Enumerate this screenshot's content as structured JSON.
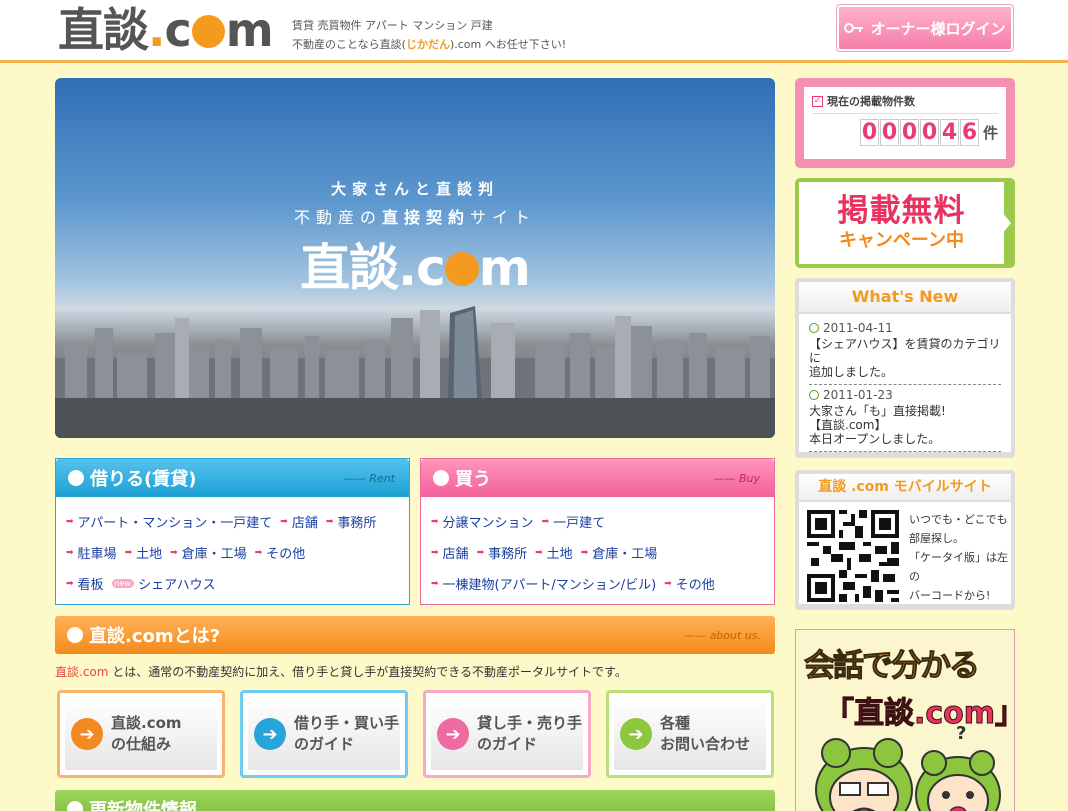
{
  "header": {
    "logo": {
      "main": "直談",
      "dot": ".",
      "c": "c",
      "m": "m"
    },
    "tagline_line1": "賃貸 売買物件 アパート マンション 戸建",
    "tagline_pre": "不動産のことなら直談(",
    "tagline_highlight": "じかだん",
    "tagline_post": ").com へお任せ下さい!",
    "owner_login": "オーナー様ログイン"
  },
  "hero": {
    "line1": "大家さんと直談判",
    "line2_pre": "不動産の",
    "line2_bold": "直接契約",
    "line2_post": "サイト",
    "logo_main": "直談.c",
    "logo_tail": "m"
  },
  "rent": {
    "title": "借りる(賃貸)",
    "en": "Rent",
    "rows": [
      [
        "アパート・マンション・一戸建て",
        "店舗",
        "事務所"
      ],
      [
        "駐車場",
        "土地",
        "倉庫・工場",
        "その他"
      ],
      [
        "看板"
      ]
    ],
    "new_badge": "new",
    "new_item": "シェアハウス"
  },
  "buy": {
    "title": "買う",
    "en": "Buy",
    "rows": [
      [
        "分譲マンション",
        "一戸建て"
      ],
      [
        "店舗",
        "事務所",
        "土地",
        "倉庫・工場"
      ],
      [
        "一棟建物(アパート/マンション/ビル)",
        "その他"
      ]
    ]
  },
  "about": {
    "title": "直談.comとは?",
    "en": "about us.",
    "brand": "直談.com",
    "text": " とは、通常の不動産契約に加え、借り手と貸し手が直接契約できる不動産ポータルサイトです。",
    "guides": [
      "直談.com\nの仕組み",
      "借り手・買い手\nのガイド",
      "貸し手・売り手\nのガイド",
      "各種\nお問い合わせ"
    ]
  },
  "update": {
    "title": "更新物件情報"
  },
  "counter": {
    "title": "現在の掲載物件数",
    "digits": [
      "0",
      "0",
      "0",
      "0",
      "4",
      "6"
    ],
    "unit": "件"
  },
  "free": {
    "big": "掲載無料",
    "small": "キャンペーン中"
  },
  "news": {
    "title": "What's New",
    "entries": [
      {
        "date": "2011-04-11",
        "text_l1": "【シェアハウス】を賃貸のカテゴリに",
        "text_l2": "追加しました。"
      },
      {
        "date": "2011-01-23",
        "text_l1": "大家さん「も」直接掲載!",
        "text_l2": "【直談.com】",
        "text_l3": "本日オープンしました。"
      }
    ]
  },
  "mobile": {
    "title": "直談 .com モバイルサイト",
    "text": "いつでも・どこでも\n部屋探し。\n「ケータイ版」は左の\nバーコードから!"
  },
  "comic": {
    "line1": "会話で分かる",
    "line2": "「直談.com」"
  }
}
